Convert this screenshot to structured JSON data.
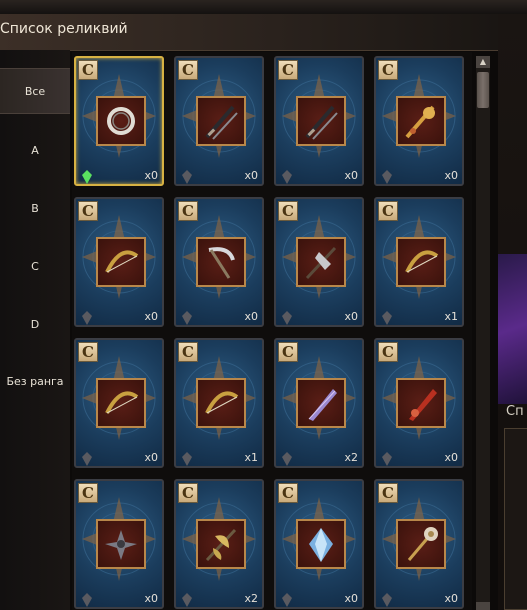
{
  "header": {
    "title": "Список реликвий"
  },
  "filters": [
    {
      "label": "Все",
      "active": true
    },
    {
      "label": "A"
    },
    {
      "label": "B"
    },
    {
      "label": "C"
    },
    {
      "label": "D"
    },
    {
      "label": "Без ранга"
    }
  ],
  "relics": [
    {
      "grade": "C",
      "count": "x0",
      "icon": "ring-icon",
      "acquired": true,
      "selected": true
    },
    {
      "grade": "C",
      "count": "x0",
      "icon": "dual-daggers-icon"
    },
    {
      "grade": "C",
      "count": "x0",
      "icon": "dual-daggers-icon"
    },
    {
      "grade": "C",
      "count": "x0",
      "icon": "ornate-sword-icon"
    },
    {
      "grade": "C",
      "count": "x0",
      "icon": "bow-icon"
    },
    {
      "grade": "C",
      "count": "x0",
      "icon": "scythe-icon"
    },
    {
      "grade": "C",
      "count": "x0",
      "icon": "axe-icon"
    },
    {
      "grade": "C",
      "count": "x1",
      "icon": "bow-icon"
    },
    {
      "grade": "C",
      "count": "x0",
      "icon": "bow-icon"
    },
    {
      "grade": "C",
      "count": "x1",
      "icon": "bow-icon"
    },
    {
      "grade": "C",
      "count": "x2",
      "icon": "blade-icon"
    },
    {
      "grade": "C",
      "count": "x0",
      "icon": "red-sword-icon"
    },
    {
      "grade": "C",
      "count": "x0",
      "icon": "shuriken-icon"
    },
    {
      "grade": "C",
      "count": "x2",
      "icon": "double-axe-icon"
    },
    {
      "grade": "C",
      "count": "x0",
      "icon": "crystal-icon"
    },
    {
      "grade": "C",
      "count": "x0",
      "icon": "staff-icon"
    }
  ],
  "right_panel": {
    "title": "Сп"
  },
  "colors": {
    "selected_border": "#d7b243",
    "card_blue": "#1b3d5d",
    "frame_red": "#4a1810"
  }
}
